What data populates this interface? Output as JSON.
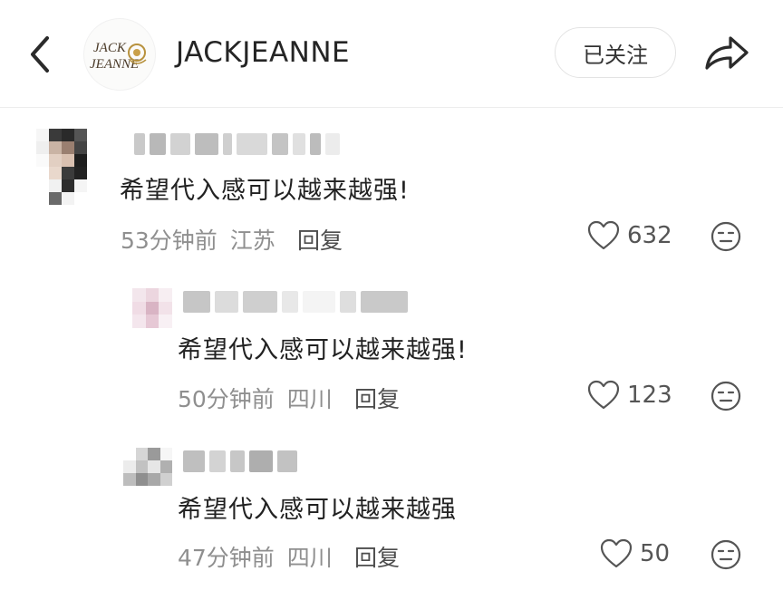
{
  "header": {
    "account_name": "JACKJEANNE",
    "logo_text_line1": "JACK",
    "logo_text_line2": "JEANNE",
    "follow_label": "已关注"
  },
  "comments": [
    {
      "text": "希望代入感可以越来越强!",
      "time": "53分钟前",
      "location": "江苏",
      "reply_label": "回复",
      "likes": "632"
    },
    {
      "text": "希望代入感可以越来越强!",
      "time": "50分钟前",
      "location": "四川",
      "reply_label": "回复",
      "likes": "123"
    },
    {
      "text": "希望代入感可以越来越强",
      "time": "47分钟前",
      "location": "四川",
      "reply_label": "回复",
      "likes": "50"
    }
  ],
  "colors": {
    "text": "#222222",
    "meta": "#8f8f8f",
    "divider": "#ececec"
  }
}
